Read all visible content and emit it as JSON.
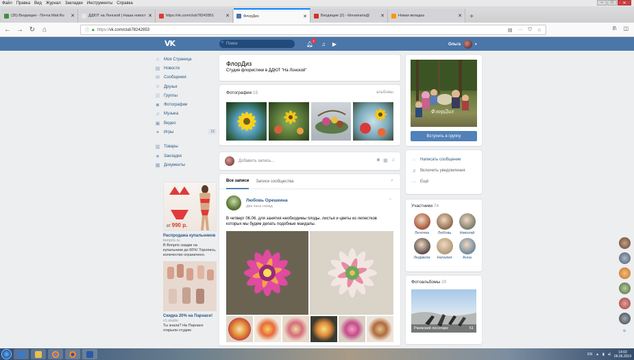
{
  "browser": {
    "menu": [
      "Файл",
      "Правка",
      "Вид",
      "Журнал",
      "Закладки",
      "Инструменты",
      "Справка"
    ],
    "tabs": [
      {
        "title": "(35) Входящие - Почта Mail.Ru",
        "favcolor": "#3f8f3f",
        "active": false
      },
      {
        "title": "ДДЮТ на Лонской | Наши новост",
        "favcolor": "#e5e5e5",
        "active": false
      },
      {
        "title": "https://vk.com/club78242851",
        "favcolor": "#e23b2e",
        "active": false
      },
      {
        "title": "ФлорДиз",
        "favcolor": "#4a76a8",
        "active": true
      },
      {
        "title": "Входящие (2) - lilovamaria@",
        "favcolor": "#d93025",
        "active": false
      },
      {
        "title": "Новая вкладка",
        "favcolor": "#ff9500",
        "active": false
      }
    ],
    "url_proto": "https://",
    "url_host": "vk.com/club78242853",
    "tab_close": "✕",
    "new_tab": "+"
  },
  "vk_header": {
    "logo": "VK",
    "search_placeholder": "Поиск",
    "notif_count": "1",
    "user_name": "Ольга"
  },
  "left_nav": [
    {
      "icon": "home-icon",
      "glyph": "⌂",
      "label": "Моя Страница"
    },
    {
      "icon": "news-icon",
      "glyph": "▤",
      "label": "Новости"
    },
    {
      "icon": "messages-icon",
      "glyph": "✉",
      "label": "Сообщения"
    },
    {
      "icon": "friends-icon",
      "glyph": "☺",
      "label": "Друзья"
    },
    {
      "icon": "groups-icon",
      "glyph": "☷",
      "label": "Группы"
    },
    {
      "icon": "photos-icon",
      "glyph": "◙",
      "label": "Фотографии"
    },
    {
      "icon": "music-icon",
      "glyph": "♫",
      "label": "Музыка"
    },
    {
      "icon": "video-icon",
      "glyph": "▣",
      "label": "Видео"
    },
    {
      "icon": "games-icon",
      "glyph": "✦",
      "label": "Игры",
      "count": "12"
    }
  ],
  "left_nav2": [
    {
      "icon": "goods-icon",
      "glyph": "▥",
      "label": "Товары"
    },
    {
      "icon": "bookmarks-icon",
      "glyph": "★",
      "label": "Закладки"
    },
    {
      "icon": "documents-icon",
      "glyph": "▦",
      "label": "Документы"
    }
  ],
  "ad1": {
    "price_prefix": "от",
    "price": "990 р.",
    "title": "Распродажа купальников",
    "domain": "bonprix.ru",
    "text": "В Bonprix скидки на купальники до 60%! Торопись, количество ограничено."
  },
  "ad2": {
    "title": "Скидка 20% на Парнасе!",
    "domain": "v1.studio",
    "text": "Ты знала? На Парнасе открыли студию"
  },
  "group": {
    "name": "ФлорДиз",
    "status": "Студия флористики в ДДЮТ \"На Лонской\""
  },
  "photos": {
    "title": "Фотографии",
    "count": "15",
    "link": "альбомы"
  },
  "post_box": {
    "placeholder": "Добавить запись..."
  },
  "wall": {
    "tab_all": "Все записи",
    "tab_community": "Записи сообщества",
    "author": "Любовь Орешкина",
    "time": "два часа назад",
    "text": "В четверг 06.06. для занятия необходимы плоды, листья и цветы из лепестков которых мы будем делать подобные мандалы."
  },
  "cover": {
    "caption": "ФлорДиз",
    "join_label": "Вступить в группу"
  },
  "actions": [
    {
      "icon": "message-icon",
      "glyph": "◌",
      "label": "Написать сообщение",
      "dim": false
    },
    {
      "icon": "bell-icon",
      "glyph": "♫",
      "label": "Включить уведомления",
      "dim": true
    },
    {
      "icon": "more-icon",
      "glyph": "···",
      "label": "Ещё",
      "dim": true
    }
  ],
  "members": {
    "title": "Участники",
    "count": "74",
    "list": [
      {
        "name": "Леночка",
        "color": "#a2533a"
      },
      {
        "name": "Любовь",
        "color": "#8a6a4a"
      },
      {
        "name": "Николай",
        "color": "#787a6c"
      },
      {
        "name": "Людмила",
        "color": "#5a4a4a"
      },
      {
        "name": "Наталия",
        "color": "#b09a78"
      },
      {
        "name": "Анна",
        "color": "#6e8a9c"
      }
    ]
  },
  "albums": {
    "title": "Фотоальбомы",
    "count": "20",
    "album_name": "Ржевский лесопарк",
    "album_count": "51"
  },
  "taskbar": {
    "lang": "EN",
    "time": "14:03",
    "date": "06.06.2019"
  }
}
